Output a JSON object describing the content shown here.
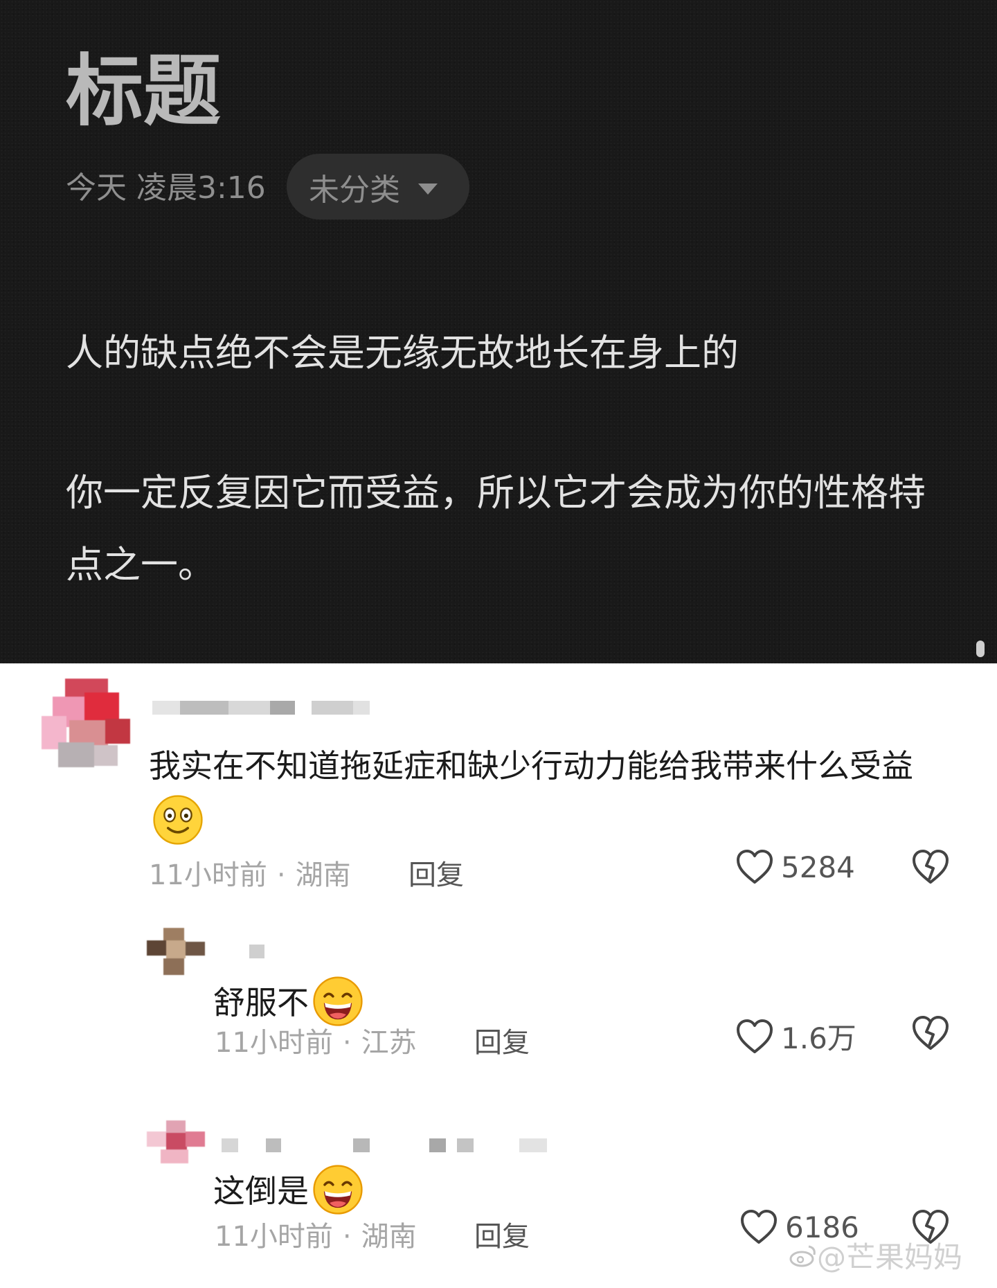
{
  "note": {
    "title": "标题",
    "timestamp": "今天 凌晨3:16",
    "category": "未分类",
    "paragraphs": [
      "人的缺点绝不会是无缘无故地长在身上的",
      "你一定反复因它而受益，所以它才会成为你的性格特点之一。"
    ]
  },
  "comments": [
    {
      "text": "我实在不知道拖延症和缺少行动力能给我带来什么受益",
      "emoji": "smiling-face-icon",
      "time": "11小时前",
      "location": "湖南",
      "reply_label": "回复",
      "likes": "5284"
    },
    {
      "text": "舒服不",
      "emoji": "grinning-face-icon",
      "time": "11小时前",
      "location": "江苏",
      "reply_label": "回复",
      "likes": "1.6万"
    },
    {
      "text": "这倒是",
      "emoji": "grinning-face-icon",
      "time": "11小时前",
      "location": "湖南",
      "reply_label": "回复",
      "likes": "6186"
    }
  ],
  "watermark": "@芒果妈妈",
  "colors": {
    "note_bg": "#191919",
    "note_text": "#e2e2e2",
    "meta_text": "#a5a5a5",
    "comment_text": "#1b1b1b"
  }
}
